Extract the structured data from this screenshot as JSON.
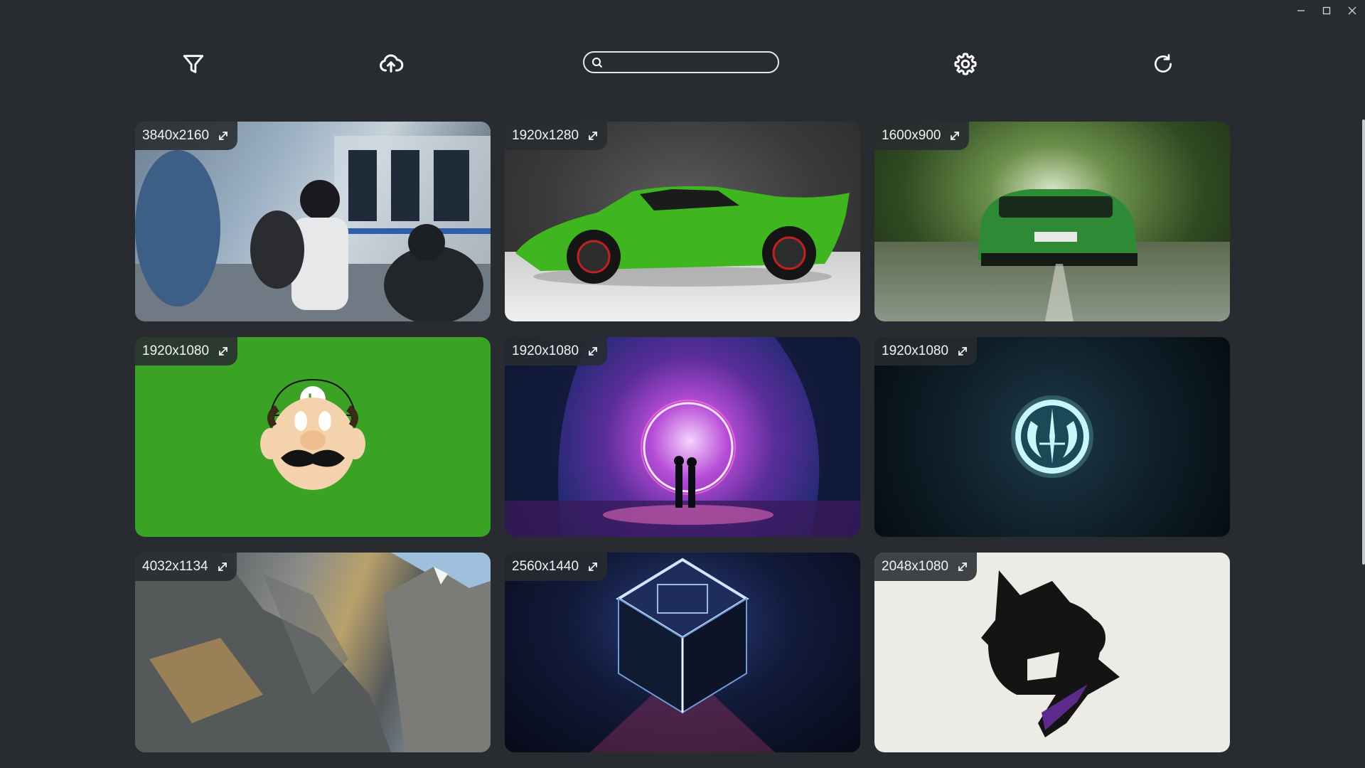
{
  "window": {
    "controls": [
      "minimize",
      "maximize",
      "close"
    ]
  },
  "toolbar": {
    "filter_icon": "filter-icon",
    "upload_icon": "cloud-upload-icon",
    "search": {
      "value": "",
      "placeholder": "",
      "icon": "search-icon"
    },
    "settings_icon": "gear-icon",
    "refresh_icon": "refresh-icon"
  },
  "gallery": {
    "items": [
      {
        "resolution": "3840x2160",
        "subject": "anime-train-station"
      },
      {
        "resolution": "1920x1280",
        "subject": "green-lamborghini"
      },
      {
        "resolution": "1600x900",
        "subject": "green-mercedes-amg-forest"
      },
      {
        "resolution": "1920x1080",
        "subject": "luigi-minimal"
      },
      {
        "resolution": "1920x1080",
        "subject": "neon-portal-couple"
      },
      {
        "resolution": "1920x1080",
        "subject": "jedi-order-emblem"
      },
      {
        "resolution": "4032x1134",
        "subject": "rocky-mountain-cliff"
      },
      {
        "resolution": "2560x1440",
        "subject": "glowing-maze-cube"
      },
      {
        "resolution": "2048x1080",
        "subject": "monstercat-logo"
      }
    ]
  },
  "colors": {
    "background": "#282b30",
    "badge_bg": "#282b30",
    "text": "#ffffff"
  }
}
